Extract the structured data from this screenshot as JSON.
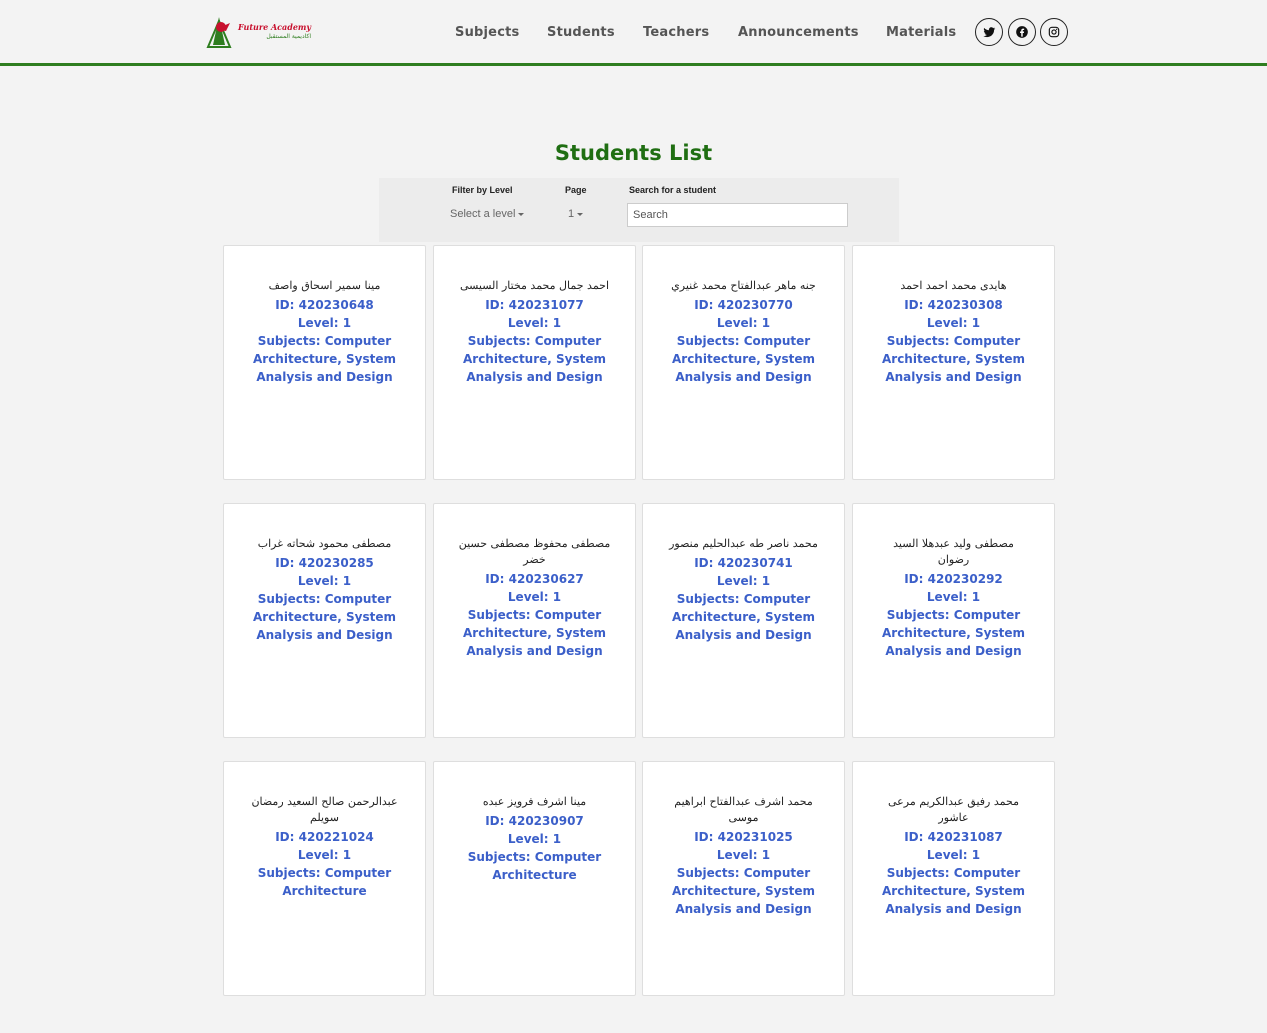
{
  "brand": {
    "name_en": "Future Academy",
    "name_ar": "اكاديمية المستقبل",
    "colors": {
      "red": "#c8102e",
      "green": "#2e7d1f"
    }
  },
  "nav": {
    "links": [
      "Subjects",
      "Students",
      "Teachers",
      "Announcements",
      "Materials"
    ],
    "social_icons": [
      "twitter-icon",
      "facebook-icon",
      "instagram-icon"
    ]
  },
  "page": {
    "title": "Students List",
    "title_color": "#1f6e12",
    "accent_color": "#3b5fc9"
  },
  "filters": {
    "level_label": "Filter by Level",
    "level_value": "Select a level",
    "page_label": "Page",
    "page_value": "1",
    "search_label": "Search for a student",
    "search_placeholder": "Search",
    "search_value": ""
  },
  "students": [
    {
      "name": "مينا سمير اسحاق واصف",
      "id": "ID: 420230648",
      "level": "Level: 1",
      "subjects": [
        "Subjects: Computer",
        "Architecture, System",
        "Analysis and Design"
      ]
    },
    {
      "name": "احمد جمال محمد مختار السيسى",
      "id": "ID: 420231077",
      "level": "Level: 1",
      "subjects": [
        "Subjects: Computer",
        "Architecture, System",
        "Analysis and Design"
      ]
    },
    {
      "name": "جنه ماهر عبدالفتاح محمد غنيري",
      "id": "ID: 420230770",
      "level": "Level: 1",
      "subjects": [
        "Subjects: Computer",
        "Architecture, System",
        "Analysis and Design"
      ]
    },
    {
      "name": "هايدى محمد احمد احمد",
      "id": "ID: 420230308",
      "level": "Level: 1",
      "subjects": [
        "Subjects: Computer",
        "Architecture, System",
        "Analysis and Design"
      ]
    },
    {
      "name": "مصطفى محمود شحاته غراب",
      "id": "ID: 420230285",
      "level": "Level: 1",
      "subjects": [
        "Subjects: Computer",
        "Architecture, System",
        "Analysis and Design"
      ]
    },
    {
      "name": "مصطفى محفوظ مصطفى حسين خضر",
      "id": "ID: 420230627",
      "level": "Level: 1",
      "subjects": [
        "Subjects: Computer",
        "Architecture, System",
        "Analysis and Design"
      ]
    },
    {
      "name": "محمد ناصر طه عبدالحليم منصور",
      "id": "ID: 420230741",
      "level": "Level: 1",
      "subjects": [
        "Subjects: Computer",
        "Architecture, System",
        "Analysis and Design"
      ]
    },
    {
      "name": "مصطفى وليد عبدهلا السيد رضوان",
      "id": "ID: 420230292",
      "level": "Level: 1",
      "subjects": [
        "Subjects: Computer",
        "Architecture, System",
        "Analysis and Design"
      ]
    },
    {
      "name": "عبدالرحمن صالح السعيد رمضان سويلم",
      "id": "ID: 420221024",
      "level": "Level: 1",
      "subjects": [
        "Subjects: Computer",
        "Architecture"
      ]
    },
    {
      "name": "مينا اشرف فرويز عبده",
      "id": "ID: 420230907",
      "level": "Level: 1",
      "subjects": [
        "Subjects: Computer",
        "Architecture"
      ]
    },
    {
      "name": "محمد اشرف عبدالفتاح ابراهيم موسى",
      "id": "ID: 420231025",
      "level": "Level: 1",
      "subjects": [
        "Subjects: Computer",
        "Architecture, System",
        "Analysis and Design"
      ]
    },
    {
      "name": "محمد رفيق عبدالكريم مرعى عاشور",
      "id": "ID: 420231087",
      "level": "Level: 1",
      "subjects": [
        "Subjects: Computer",
        "Architecture, System",
        "Analysis and Design"
      ]
    }
  ]
}
